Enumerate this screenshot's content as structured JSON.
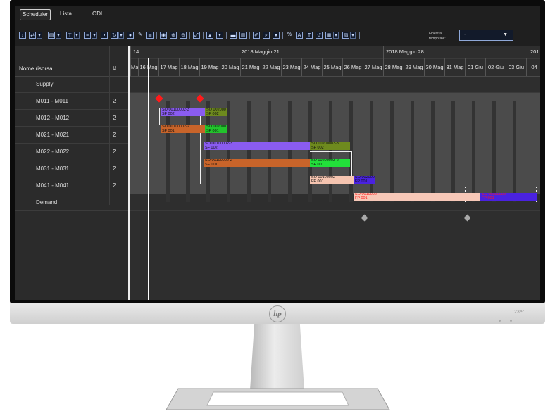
{
  "monitor": {
    "brand": "hp",
    "model": "23er"
  },
  "app": {
    "tabs": [
      {
        "label": "Scheduler",
        "active": true
      },
      {
        "label": "Lista",
        "active": false
      },
      {
        "label": "ODL",
        "active": false
      }
    ],
    "toolbar": {
      "finestra_label_1": "Finestra",
      "finestra_label_2": "temporale:",
      "finestra_value": "-",
      "finestra_caret": "▼"
    },
    "resources": {
      "header_name": "Nome risorsa",
      "header_count": "#",
      "rows": [
        {
          "name": "Supply",
          "count": ""
        },
        {
          "name": "M011 - M011",
          "count": "2"
        },
        {
          "name": "M012 - M012",
          "count": "2"
        },
        {
          "name": "M021 - M021",
          "count": "2"
        },
        {
          "name": "M022 - M022",
          "count": "2"
        },
        {
          "name": "M031 - M031",
          "count": "2"
        },
        {
          "name": "M041 - M041",
          "count": "2"
        },
        {
          "name": "Demand",
          "count": ""
        }
      ]
    },
    "timeline": {
      "weeks": [
        "14",
        "2018 Maggio 21",
        "2018 Maggio 28",
        "201"
      ],
      "days": [
        "Mag",
        "16 Mag",
        "17 Mag",
        "18 Mag",
        "19 Mag",
        "20 Mag",
        "21 Mag",
        "22 Mag",
        "23 Mag",
        "24 Mag",
        "25 Mag",
        "26 Mag",
        "27 Mag",
        "28 Mag",
        "29 Mag",
        "30 Mag",
        "31 Mag",
        "01 Giu",
        "02 Giu",
        "03 Giu",
        "04"
      ]
    },
    "bars": [
      {
        "text": "SO 00100002-3\nSF 002",
        "color": "#8a5cf0"
      },
      {
        "text": "SO 002000\nSF 002",
        "color": "#6e8a1e"
      },
      {
        "text": "SO 00100002-2\nSF 001",
        "color": "#c8642a"
      },
      {
        "text": "SO 002000\nSF 001",
        "color": "#22c42c"
      },
      {
        "text": "SO 00100002-3\nSF 002",
        "color": "#8a5cf0"
      },
      {
        "text": "SO 00200003-3\nSF 002",
        "color": "#6e8a1e"
      },
      {
        "text": "SO 00100002-2\nSF 001",
        "color": "#c8642a"
      },
      {
        "text": "SO 00200003-2\nSF 001",
        "color": "#22e03a"
      },
      {
        "text": "SO 00100002\nFP 001",
        "color": "#f5c4b0"
      },
      {
        "text": "SO 002000\nFP 001",
        "color": "#4a22e0"
      },
      {
        "text": "SO 0010002\nFP 001",
        "color": "#f7c8b8",
        "text_color": "#ff1a1a"
      },
      {
        "text": "SO 00200002\nFP 001",
        "color": "#4a22e0",
        "text_color": "#ff1a1a"
      }
    ]
  }
}
